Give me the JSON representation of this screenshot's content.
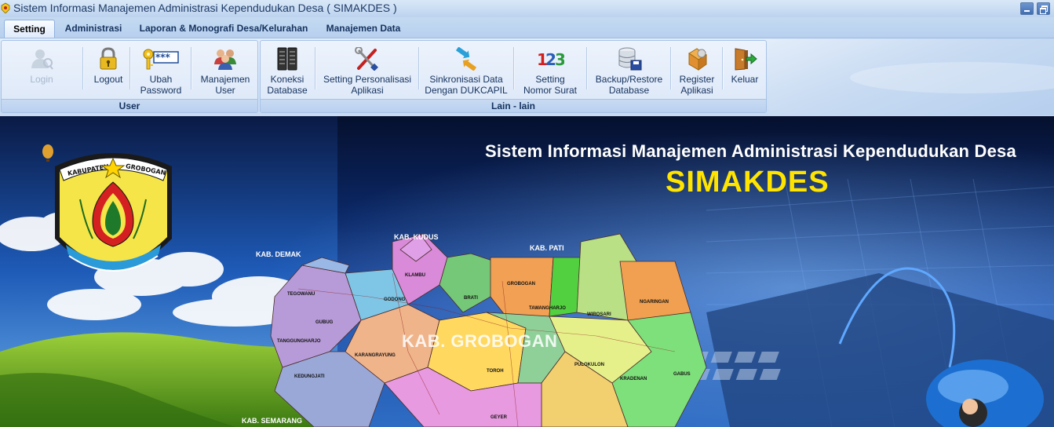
{
  "window": {
    "title": "Sistem Informasi Manajemen Administrasi Kependudukan Desa ( SIMAKDES )"
  },
  "tabs": [
    {
      "label": "Setting",
      "active": true
    },
    {
      "label": "Administrasi",
      "active": false
    },
    {
      "label": "Laporan & Monografi Desa/Kelurahan",
      "active": false
    },
    {
      "label": "Manajemen Data",
      "active": false
    }
  ],
  "ribbon": {
    "groups": [
      {
        "label": "User",
        "buttons": [
          {
            "line1": "Login",
            "line2": "",
            "icon": "login-user-icon",
            "enabled": false
          },
          {
            "line1": "Logout",
            "line2": "",
            "icon": "padlock-icon",
            "enabled": true
          },
          {
            "line1": "Ubah",
            "line2": "Password",
            "icon": "key-password-icon",
            "enabled": true
          },
          {
            "line1": "Manajemen",
            "line2": "User",
            "icon": "users-group-icon",
            "enabled": true
          }
        ]
      },
      {
        "label": "Lain - lain",
        "buttons": [
          {
            "line1": "Koneksi",
            "line2": "Database",
            "icon": "server-icon",
            "enabled": true
          },
          {
            "line1": "Setting Personalisasi",
            "line2": "Aplikasi",
            "icon": "tools-icon",
            "enabled": true
          },
          {
            "line1": "Sinkronisasi Data",
            "line2": "Dengan DUKCAPIL",
            "icon": "sync-arrows-icon",
            "enabled": true
          },
          {
            "line1": "Setting",
            "line2": "Nomor Surat",
            "icon": "numbers-123-icon",
            "enabled": true
          },
          {
            "line1": "Backup/Restore",
            "line2": "Database",
            "icon": "database-save-icon",
            "enabled": true
          },
          {
            "line1": "Register",
            "line2": "Aplikasi",
            "icon": "register-icon",
            "enabled": true
          },
          {
            "line1": "Keluar",
            "line2": "",
            "icon": "exit-door-icon",
            "enabled": true
          }
        ]
      }
    ]
  },
  "banner": {
    "title": "Sistem Informasi Manajemen Administrasi Kependudukan Desa",
    "brand": "SIMAKDES",
    "emblem": {
      "top": "KABUPATEN",
      "top2": "GROBOGAN"
    },
    "map_title": "KAB. GROBOGAN",
    "neighbors": [
      "KAB. KUDUS",
      "KAB. DEMAK",
      "KAB. PATI",
      "KAB. SEMARANG"
    ],
    "districts": [
      "TEGOWANU",
      "KLAMBU",
      "GODONG",
      "BRATI",
      "GROBOGAN",
      "TAWANGHARJO",
      "WIROSARI",
      "NGARINGAN",
      "GUBUG",
      "TANGGUNGHARJO",
      "KARANGRAYUNG",
      "PULOKULON",
      "KRADENAN",
      "GABUS",
      "KEDUNGJATI",
      "TOROH",
      "GEYER"
    ],
    "colors": {
      "title": "#ffffff",
      "brand": "#ffe400"
    }
  }
}
